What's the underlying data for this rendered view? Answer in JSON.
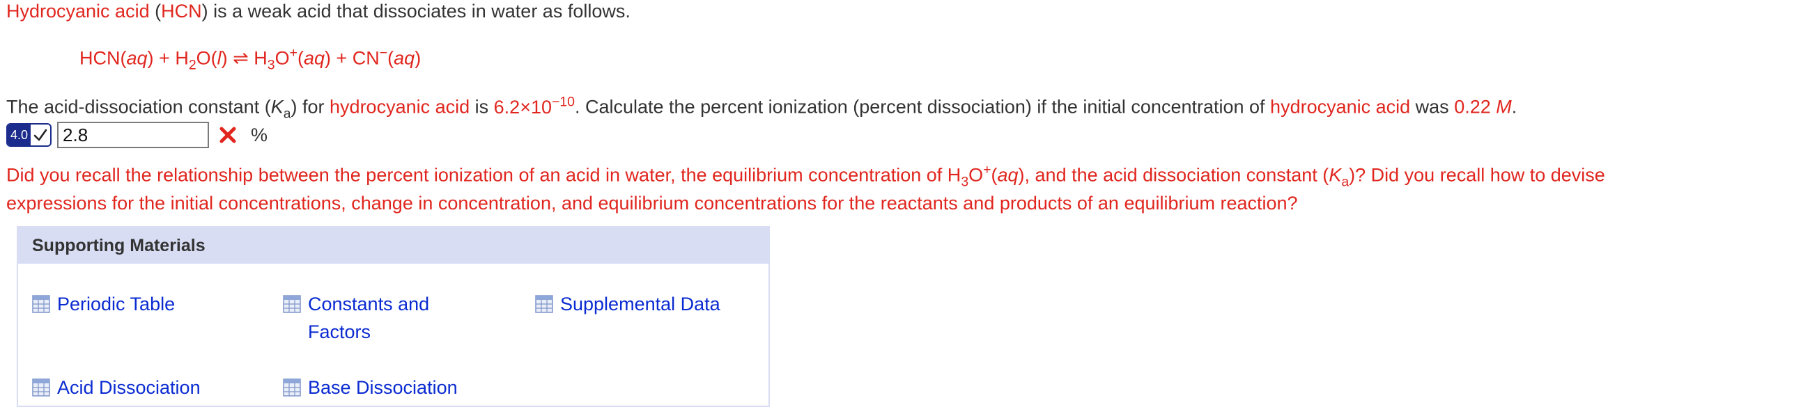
{
  "question": {
    "intro": {
      "acid_name": "Hydrocyanic acid",
      "open_paren": " (",
      "formula": "HCN",
      "rest": ") is a weak acid that dissociates in water as follows."
    },
    "equation": {
      "reactant1": "HCN(",
      "reactant1_state": "aq",
      "reactant1_close": ")",
      "plus1": " + H",
      "h2o_sub": "2",
      "h2o_o": "O(",
      "h2o_state": "l",
      "h2o_close": ")",
      "arrow": " ⇌ ",
      "h3o": "H",
      "h3o_sub": "3",
      "h3o_o": "O",
      "h3o_sup": "+",
      "h3o_state_open": "(",
      "h3o_state": "aq",
      "h3o_state_close": ")",
      "plus2": " + CN",
      "cn_sup": "−",
      "cn_state_open": "(",
      "cn_state": "aq",
      "cn_state_close": ")"
    },
    "prompt": {
      "p1": "The acid-dissociation constant (",
      "k": "K",
      "k_sub": "a",
      "p2": ") for ",
      "acid_name": "hydrocyanic acid",
      "p3": " is ",
      "ka_base": "6.2×10",
      "ka_exp": "−10",
      "p4": ". Calculate the percent ionization (percent dissociation) if the initial concentration of ",
      "acid_name2": "hydrocyanic acid",
      "p5": " was ",
      "conc": "0.22",
      "unit": "M",
      "p6": "."
    }
  },
  "answer": {
    "version": "4.0",
    "value": "2.8",
    "unit": "%",
    "status": "incorrect"
  },
  "feedback": {
    "line1_a": "Did you recall the relationship between the percent ionization of an acid in water, the equilibrium concentration of H",
    "line1_sub": "3",
    "line1_o": "O",
    "line1_sup": "+",
    "line1_state_open": "(",
    "line1_state": "aq",
    "line1_state_close": "), and the acid dissociation constant (",
    "line1_k": "K",
    "line1_k_sub": "a",
    "line1_b": ")? Did you recall how to devise",
    "line2": "expressions for the initial concentrations, change in concentration, and equilibrium concentrations for the reactants and products of an equilibrium reaction?"
  },
  "supporting_materials": {
    "title": "Supporting Materials",
    "items": [
      {
        "label": "Periodic Table"
      },
      {
        "label": "Constants and Factors"
      },
      {
        "label": "Supplemental Data"
      },
      {
        "label": "Acid Dissociation"
      },
      {
        "label": "Base Dissociation"
      }
    ]
  },
  "colors": {
    "highlight": "#e0261e",
    "link": "#0a2bd1",
    "panel_header": "#d8ddf4",
    "badge": "#1b2c8c"
  }
}
